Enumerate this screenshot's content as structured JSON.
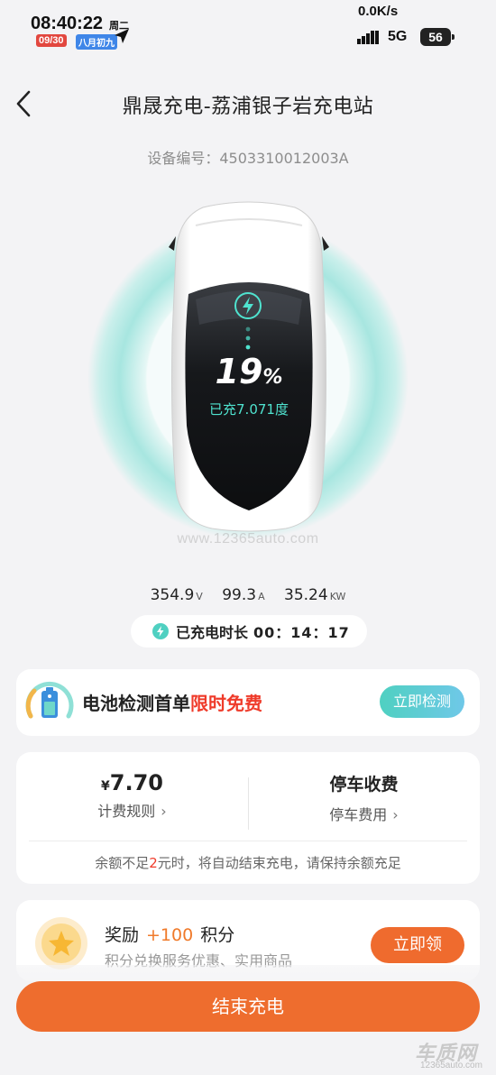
{
  "status_bar": {
    "time": "08:40:22",
    "weekday": "周二",
    "date": "09/30",
    "lunar": "八月初九",
    "speed": "0.0K/s",
    "network": "5G",
    "battery": "56"
  },
  "header": {
    "title": "鼎晟充电-荔浦银子岩充电站",
    "device_no": "设备编号：4503310012003A"
  },
  "charging": {
    "percent": "19",
    "percent_unit": "%",
    "charged_text": "已充7.071度",
    "watermark": "www.12365auto.com"
  },
  "stats": {
    "voltage": "354.9",
    "voltage_unit": "V",
    "current": "99.3",
    "current_unit": "A",
    "power": "35.24",
    "power_unit": "KW"
  },
  "duration": {
    "label": "已充电时长",
    "value": "00：14：17"
  },
  "promo": {
    "text_main": "电池检测首单",
    "text_highlight": "限时免费",
    "button": "立即检测"
  },
  "fees": {
    "currency": "¥",
    "amount": "7.70",
    "rule_label": "计费规则",
    "parking_title": "停车收费",
    "parking_label": "停车费用",
    "note_prefix": "余额不足",
    "note_amount": "2",
    "note_suffix": "元时，将自动结束充电，请保持余额充足"
  },
  "reward": {
    "title": "奖励",
    "points": "+100",
    "points_unit": "积分",
    "subtitle": "积分兑换服务优惠、实用商品",
    "button": "立即领"
  },
  "end_button": "结束充电",
  "brand": {
    "cn": "车质网",
    "en": "12365auto.com"
  },
  "colors": {
    "accent_orange": "#ee6d2e",
    "accent_teal": "#4fd0c1",
    "highlight_red": "#ef3b2a"
  }
}
